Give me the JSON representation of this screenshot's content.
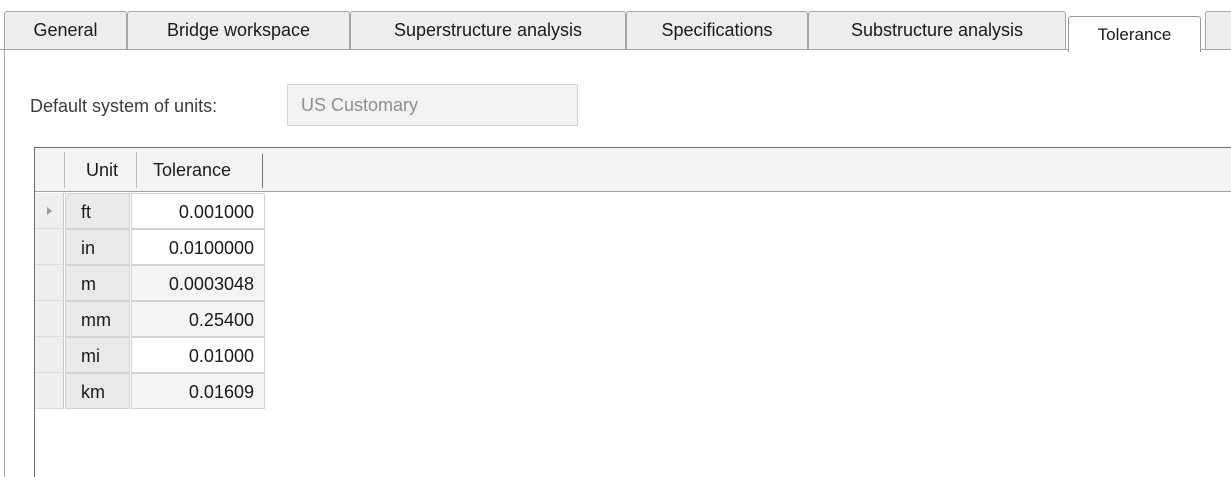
{
  "tabs": [
    {
      "label": "General"
    },
    {
      "label": "Bridge workspace"
    },
    {
      "label": "Superstructure analysis"
    },
    {
      "label": "Specifications"
    },
    {
      "label": "Substructure analysis"
    },
    {
      "label": "Tolerance",
      "active": true
    }
  ],
  "units": {
    "label": "Default system of units:",
    "value": "US Customary"
  },
  "grid": {
    "columns": [
      "Unit",
      "Tolerance"
    ],
    "rows": [
      {
        "unit": "ft",
        "tolerance": "0.001000"
      },
      {
        "unit": "in",
        "tolerance": "0.0100000"
      },
      {
        "unit": "m",
        "tolerance": "0.0003048"
      },
      {
        "unit": "mm",
        "tolerance": "0.25400"
      },
      {
        "unit": "mi",
        "tolerance": "0.01000"
      },
      {
        "unit": "km",
        "tolerance": "0.01609"
      }
    ]
  }
}
